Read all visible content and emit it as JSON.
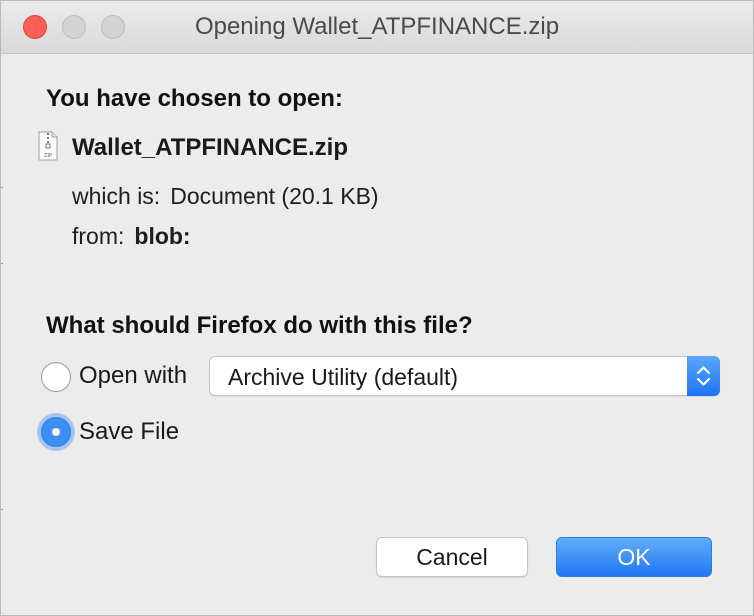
{
  "window": {
    "title": "Opening Wallet_ATPFINANCE.zip"
  },
  "dialog": {
    "chosen_heading": "You have chosen to open:",
    "file": {
      "name": "Wallet_ATPFINANCE.zip",
      "icon_text": "ZIP",
      "which_is_label": "which is:",
      "which_is_value": "Document (20.1 KB)",
      "from_label": "from:",
      "from_value": "blob:"
    },
    "question": "What should Firefox do with this file?",
    "options": {
      "open_with_label": "Open with",
      "open_with_app": "Archive Utility (default)",
      "save_file_label": "Save File",
      "selected": "save_file"
    },
    "buttons": {
      "cancel": "Cancel",
      "ok": "OK"
    }
  }
}
